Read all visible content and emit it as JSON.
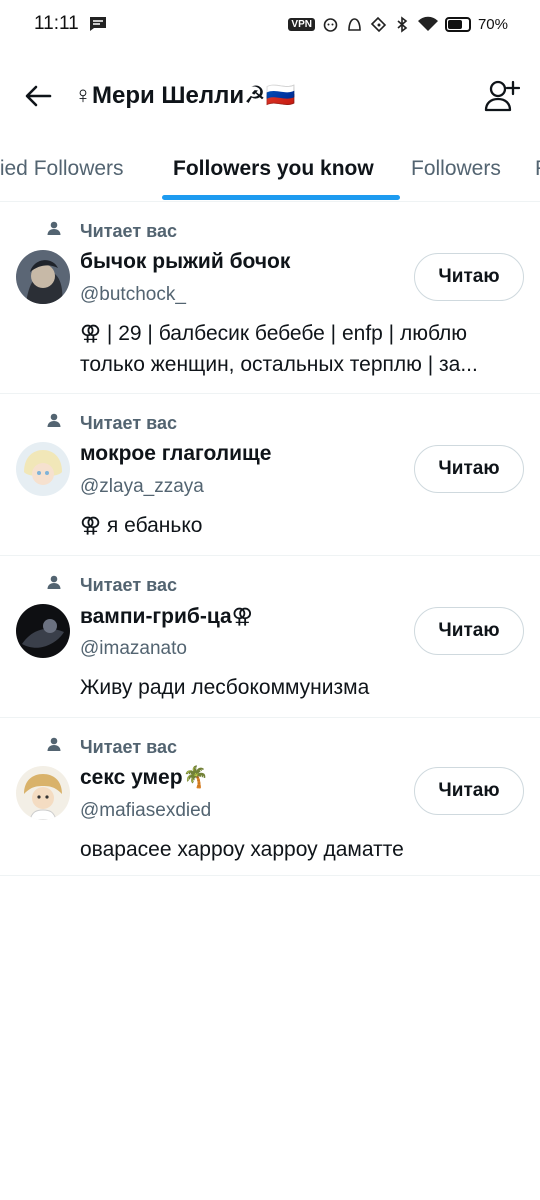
{
  "status_bar": {
    "time": "11:11",
    "vpn_label": "VPN",
    "battery": "70%",
    "battery_level": 0.7
  },
  "header": {
    "title": "♀Мери Шелли☭🇷🇺"
  },
  "tabs": [
    {
      "label": "fied Followers",
      "active": false
    },
    {
      "label": "Followers you know",
      "active": true
    },
    {
      "label": "Followers",
      "active": false
    },
    {
      "label": "F",
      "active": false
    }
  ],
  "followers": [
    {
      "context": "Читает вас",
      "name": "бычок рыжий бочок",
      "handle": "@butchock_",
      "bio_lines": [
        "⚢ | 29 | балбесик бебебе | enfp | люблю",
        "только женщин, остальных терплю | за..."
      ],
      "button": "Читаю"
    },
    {
      "context": "Читает вас",
      "name": "мокрое глаголище",
      "handle": "@zlaya_zzaya",
      "bio_lines": [
        "⚢ я ебанько"
      ],
      "button": "Читаю"
    },
    {
      "context": "Читает вас",
      "name": "вампи-гриб-ца⚢",
      "handle": "@imazanato",
      "bio_lines": [
        "Живу ради лесбокоммунизма"
      ],
      "button": "Читаю"
    },
    {
      "context": "Читает вас",
      "name": "секс умер🌴",
      "handle": "@mafiasexdied",
      "bio_lines": [
        "оварасее харроу харроу даматте"
      ],
      "button": "Читаю"
    }
  ]
}
